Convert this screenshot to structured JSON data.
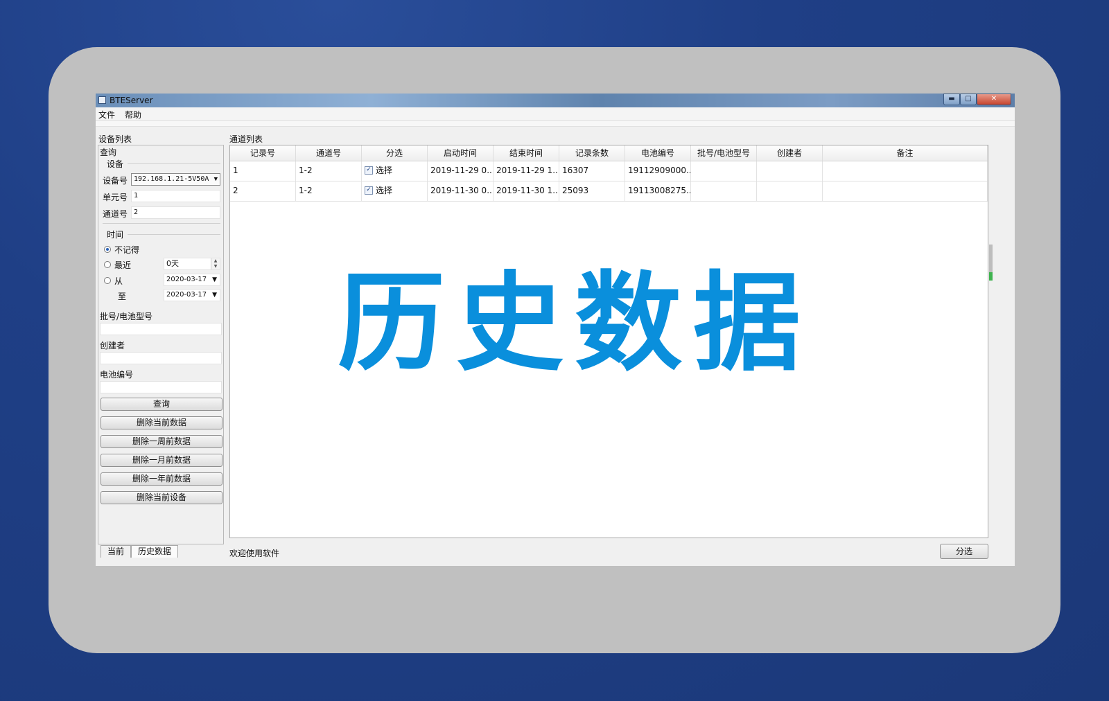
{
  "window": {
    "title": "BTEServer",
    "min_glyph": "▬",
    "max_glyph": "□",
    "close_glyph": "✕"
  },
  "menu": {
    "file": "文件",
    "help": "帮助"
  },
  "left": {
    "device_list_label": "设备列表",
    "query_group": "查询",
    "device_group": "设备",
    "device_no_label": "设备号",
    "device_no_value": "192.168.1.21-5V50A",
    "unit_no_label": "单元号",
    "unit_no_value": "1",
    "channel_no_label": "通道号",
    "channel_no_value": "2",
    "time_group": "时间",
    "radio_none": "不记得",
    "radio_recent": "最近",
    "recent_value": "0天",
    "radio_from": "从",
    "from_date": "2020-03-17",
    "to_label": "至",
    "to_date": "2020-03-17",
    "batch_label": "批号/电池型号",
    "batch_value": "",
    "creator_label": "创建者",
    "creator_value": "",
    "battery_no_label": "电池编号",
    "battery_no_value": "",
    "buttons": {
      "query": "查询",
      "delete_current": "删除当前数据",
      "delete_week": "删除一周前数据",
      "delete_month": "删除一月前数据",
      "delete_year": "删除一年前数据",
      "delete_device": "删除当前设备"
    },
    "tabs": {
      "current": "当前",
      "history": "历史数据"
    }
  },
  "main": {
    "channel_list_label": "通道列表",
    "columns": [
      "记录号",
      "通道号",
      "分选",
      "启动时间",
      "结束时间",
      "记录条数",
      "电池编号",
      "批号/电池型号",
      "创建者",
      "备注"
    ],
    "rows": [
      {
        "record": "1",
        "channel": "1-2",
        "select": "选择",
        "start": "2019-11-29 0...",
        "end": "2019-11-29 1...",
        "count": "16307",
        "battery": "19112909000...",
        "batch": "",
        "creator": "",
        "note": ""
      },
      {
        "record": "2",
        "channel": "1-2",
        "select": "选择",
        "start": "2019-11-30 0...",
        "end": "2019-11-30 1...",
        "count": "25093",
        "battery": "19113008275...",
        "batch": "",
        "creator": "",
        "note": ""
      }
    ],
    "overlay_title": "历史数据",
    "status_text": "欢迎使用软件",
    "sort_button": "分选"
  },
  "colors": {
    "overlay": "#0a8fdc",
    "background": "#1f3f86",
    "frame": "#c0c0c0"
  }
}
